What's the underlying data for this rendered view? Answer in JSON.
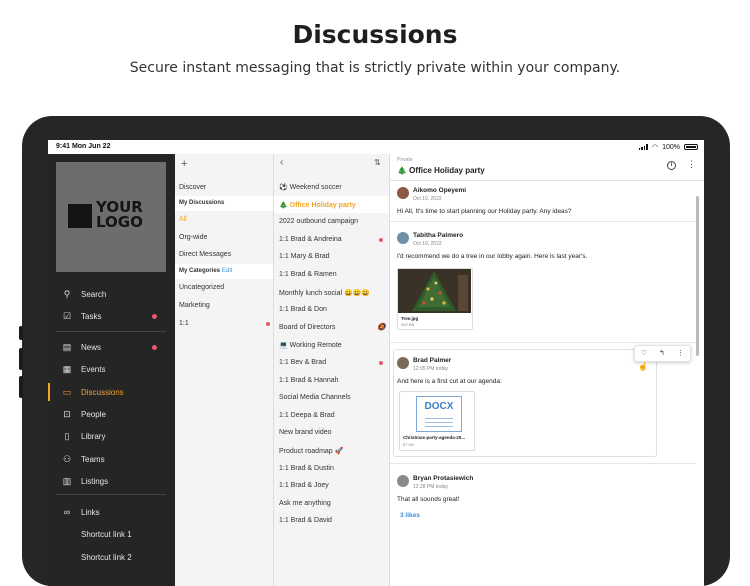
{
  "hero": {
    "title": "Discussions",
    "subtitle": "Secure instant messaging that is strictly private within your company."
  },
  "status_bar": {
    "time": "9:41  Mon Jun 22",
    "battery": "100%"
  },
  "logo": {
    "line1": "YOUR",
    "line2": "LOGO"
  },
  "sidebar": {
    "items": [
      {
        "label": "Search",
        "icon": "search-icon"
      },
      {
        "label": "Tasks",
        "icon": "checkbox-icon",
        "badge": true
      },
      {
        "label": "News",
        "icon": "news-icon",
        "badge": true
      },
      {
        "label": "Events",
        "icon": "calendar-icon"
      },
      {
        "label": "Discussions",
        "icon": "chat-icon",
        "active": true
      },
      {
        "label": "People",
        "icon": "person-icon"
      },
      {
        "label": "Library",
        "icon": "book-icon"
      },
      {
        "label": "Teams",
        "icon": "teams-icon"
      },
      {
        "label": "Listings",
        "icon": "listings-icon"
      },
      {
        "label": "Links",
        "icon": "link-icon"
      },
      {
        "label": "Shortcut link 1"
      },
      {
        "label": "Shortcut link 2"
      }
    ]
  },
  "categories": {
    "items": [
      {
        "label": "Discover"
      },
      {
        "label": "My Discussions",
        "header": true
      },
      {
        "label": "All",
        "selected": true
      },
      {
        "label": "Org-wide"
      },
      {
        "label": "Direct Messages"
      },
      {
        "label": "My Categories",
        "header": true
      },
      {
        "label": "Uncategorized"
      },
      {
        "label": "Marketing"
      },
      {
        "label": "1:1",
        "unread": true
      }
    ],
    "edit_label": "Edit"
  },
  "discussions": {
    "items": [
      {
        "label": "⚽ Weekend soccer"
      },
      {
        "label": "🎄 Office Holiday party",
        "selected": true
      },
      {
        "label": "2022 outbound campaign"
      },
      {
        "label": "1:1 Brad & Andreina",
        "unread": true
      },
      {
        "label": "1:1 Mary & Brad"
      },
      {
        "label": "1:1 Brad & Ramen"
      },
      {
        "label": "Monthly lunch social 😀😀😀"
      },
      {
        "label": "1:1 Brad & Don"
      },
      {
        "label": "Board of Directors",
        "muted": true
      },
      {
        "label": "💻 Working Remote"
      },
      {
        "label": "1:1 Bev & Brad",
        "unread": true
      },
      {
        "label": "1:1 Brad & Hannah"
      },
      {
        "label": "Social Media Channels"
      },
      {
        "label": "1:1 Deepa & Brad"
      },
      {
        "label": "New brand video"
      },
      {
        "label": "Product roadmap 🚀"
      },
      {
        "label": "1:1 Brad & Dustin"
      },
      {
        "label": "1:1 Brad & Joey"
      },
      {
        "label": "Ask me anything"
      },
      {
        "label": "1:1 Brad & David"
      }
    ]
  },
  "chat": {
    "private_label": "Private",
    "title": "🎄 Office Holiday party",
    "messages": [
      {
        "name": "Aikomo Opeyemi",
        "time": "Oct 10, 2022",
        "text": "Hi All, It's time to start planning our Holiday party. Any ideas?"
      },
      {
        "name": "Tabitha Palmero",
        "time": "Oct 10, 2022",
        "text": "I'd recommend we do a tree in our lobby again. Here is last year's.",
        "attachment": {
          "name": "Tree.jpg",
          "size": "302 KB"
        }
      },
      {
        "name": "Brad Palmer",
        "time": "12:05 PM today",
        "text": "And here is a first cut at our agenda:",
        "attachment": {
          "name": "Christmas-party-agenda-20...",
          "size": "87 KB",
          "type_label": "DOCX"
        }
      },
      {
        "name": "Bryan Protasiewich",
        "time": "12:28 PM today",
        "text": "That all sounds great!",
        "likes": "3 likes"
      }
    ]
  },
  "colors": {
    "accent": "#f3a52b",
    "sidebar_bg": "#252525",
    "badge": "#e35d6a",
    "link": "#3b8fd6"
  }
}
